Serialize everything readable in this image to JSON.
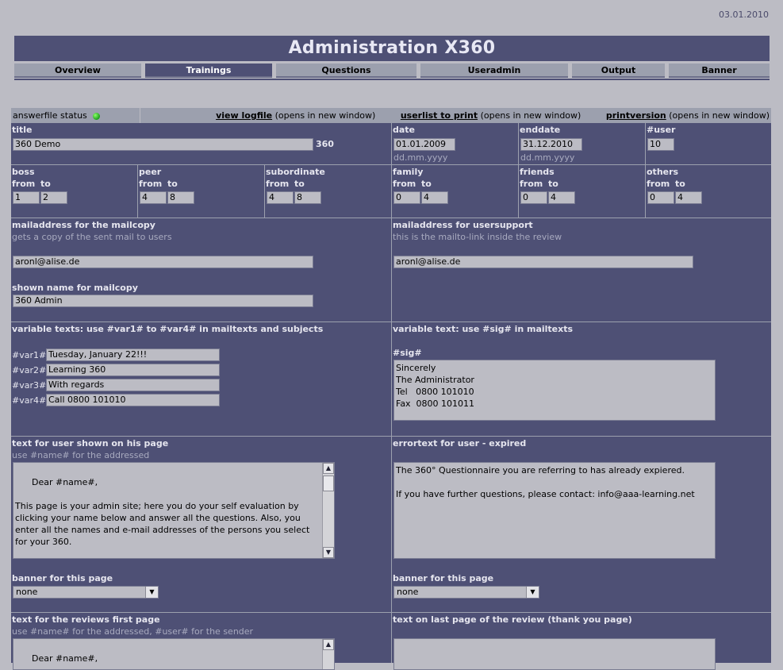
{
  "header": {
    "date": "03.01.2010",
    "title": "Administration X360"
  },
  "nav": [
    {
      "label": "Overview",
      "active": false
    },
    {
      "label": "Trainings",
      "active": true
    },
    {
      "label": "Questions",
      "active": false
    },
    {
      "label": "Useradmin",
      "active": false
    },
    {
      "label": "Output",
      "active": false
    },
    {
      "label": "Banner",
      "active": false
    }
  ],
  "status": {
    "label": "answerfile status",
    "indicator": "green-led-icon",
    "links": [
      {
        "link": "view logfile",
        "note": " (opens in new window)"
      },
      {
        "link": "userlist to print",
        "note": " (opens in new window)"
      },
      {
        "link": "printversion",
        "note": " (opens in new window)"
      }
    ]
  },
  "form": {
    "title_label": "title",
    "title_value": "360 Demo",
    "title_suffix": "360",
    "date_label": "date",
    "date_value": "01.01.2009",
    "date_hint": "dd.mm.yyyy",
    "enddate_label": "enddate",
    "enddate_value": "31.12.2010",
    "enddate_hint": "dd.mm.yyyy",
    "user_label": "#user",
    "user_value": "10",
    "from_label": "from",
    "to_label": "to",
    "groups": [
      {
        "name": "boss",
        "from": "1",
        "to": "2"
      },
      {
        "name": "peer",
        "from": "4",
        "to": "8"
      },
      {
        "name": "subordinate",
        "from": "4",
        "to": "8"
      },
      {
        "name": "family",
        "from": "0",
        "to": "4"
      },
      {
        "name": "friends",
        "from": "0",
        "to": "4"
      },
      {
        "name": "others",
        "from": "0",
        "to": "4"
      }
    ],
    "mailcopy_label": "mailaddress for the mailcopy",
    "mailcopy_hint": "gets a copy of the sent mail to users",
    "mailcopy_value": "aronl@alise.de",
    "shownname_label": "shown name for mailcopy",
    "shownname_value": "360 Admin",
    "usersupport_label": "mailaddress for usersupport",
    "usersupport_hint": "this is the mailto-link inside the review",
    "usersupport_value": "aronl@alise.de",
    "vartexts_label": "variable texts: use #var1# to #var4# in mailtexts and subjects",
    "vars": [
      {
        "key": "#var1#",
        "value": "Tuesday, January 22!!!"
      },
      {
        "key": "#var2#",
        "value": "Learning 360"
      },
      {
        "key": "#var3#",
        "value": "With regards"
      },
      {
        "key": "#var4#",
        "value": "Call 0800 101010"
      }
    ],
    "sig_section_label": "variable text: use #sig# in mailtexts",
    "sig_label": "#sig#",
    "sig_value": "Sincerely\nThe Administrator\nTel   0800 101010\nFax  0800 101011",
    "userpage_label": "text for user shown on his page",
    "userpage_hint": "use #name# for the addressed",
    "userpage_value": "Dear #name#,\n\nThis page is your admin site; here you do your self evaluation by clicking your name below and answer all the questions. Also, you enter all the names and e-mail addresses of the persons you select for your 360.\n\nPlease make sure not just send the mails out but call every person",
    "expired_label": "errortext for user - expired",
    "expired_value": "The 360° Questionnaire you are referring to has already expiered.\n\nIf you have further questions, please contact: info@aaa-learning.net",
    "banner_label": "banner for this page",
    "banner_left": "none",
    "banner_right": "none",
    "review_first_label": "text for the reviews first page",
    "review_first_hint": "use #name# for the addressed, #user# for the sender",
    "review_first_value": "Dear #name#,",
    "review_last_label": "text on last page of the review (thank you page)"
  }
}
